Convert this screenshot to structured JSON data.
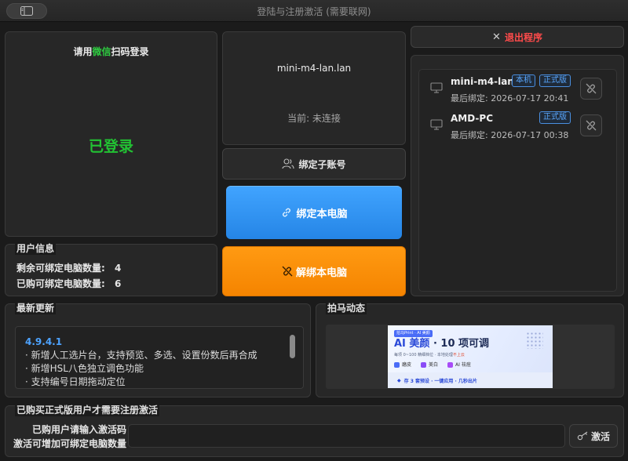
{
  "window": {
    "title": "登陆与注册激活 (需要联网)"
  },
  "qr_panel": {
    "prompt_prefix": "请用",
    "prompt_wechat": "微信",
    "prompt_suffix": "扫码登录",
    "status": "已登录"
  },
  "device_panel": {
    "hostname": "mini-m4-lan.lan",
    "current": "当前: 未连接"
  },
  "buttons": {
    "bind_sub_account": "绑定子账号",
    "bind_this_pc": "绑定本电脑",
    "unbind_this_pc": "解绑本电脑",
    "exit_program": "退出程序",
    "activate": "激活"
  },
  "user_info": {
    "title": "用户信息",
    "remaining_label": "剩余可绑定电脑数量:",
    "remaining_value": "4",
    "purchased_label": "已购可绑定电脑数量:",
    "purchased_value": "6"
  },
  "bound_devices": [
    {
      "name": "mini-m4-lan.lan",
      "last_bind": "最后绑定: 2026-07-17 20:41",
      "badges": [
        "本机",
        "正式版"
      ]
    },
    {
      "name": "AMD-PC",
      "last_bind": "最后绑定: 2026-07-17 00:38",
      "badges": [
        "正式版"
      ]
    }
  ],
  "changelog": {
    "title": "最新更新",
    "version": "4.9.4.1",
    "lines": [
      "· 新增人工选片台，支持预览、多选、设置份数后再合成",
      "· 新增HSL八色独立调色功能",
      "· 支持编号日期拖动定位"
    ]
  },
  "news": {
    "title": "拍马动态",
    "banner": {
      "tag": "拍马Print · AI 美颜",
      "headline_a": "AI 美颜",
      "headline_b": "· 10 项可调",
      "subline": "每项 0~100 精细档位 · 本地处理",
      "subline_hl": "不上云",
      "feature_1": "磨皮",
      "feature_2": "美白",
      "feature_3": "AI 祛痘",
      "footer": "存 3 套预设 · 一键应用 · 几秒出片"
    }
  },
  "activation": {
    "title": "已购买正式版用户才需要注册激活",
    "hint_line1": "已购用户请输入激活码",
    "hint_line2": "激活可增加可绑定电脑数量",
    "code_value": ""
  },
  "colors": {
    "wechat_green": "#2ecc40",
    "logged_in_green": "#22c233",
    "bind_blue": "#2d92f0",
    "unbind_orange": "#fb8b00",
    "exit_red": "#ff4b4b",
    "link_blue": "#4da3ff"
  }
}
